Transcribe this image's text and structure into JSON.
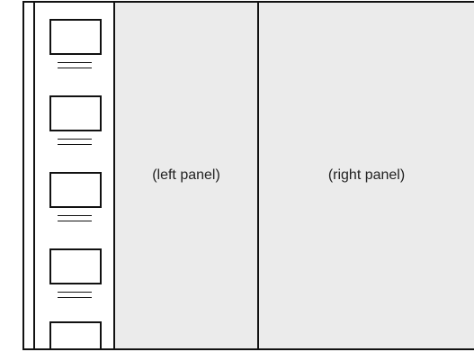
{
  "thumbnails": [
    {
      "id": 1
    },
    {
      "id": 2
    },
    {
      "id": 3
    },
    {
      "id": 4
    },
    {
      "id": 5
    }
  ],
  "panels": {
    "left_label": "(left panel)",
    "right_label": "(right panel)"
  }
}
